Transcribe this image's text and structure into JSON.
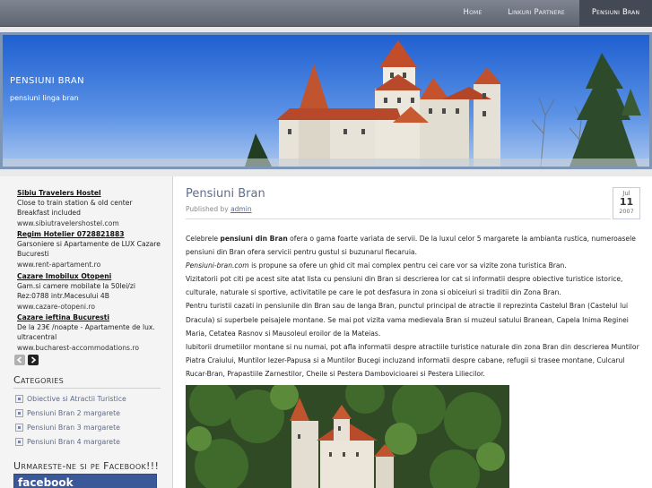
{
  "nav": {
    "items": [
      {
        "label": "Home"
      },
      {
        "label": "Linkuri Partnere"
      },
      {
        "label": "Pensiuni Bran",
        "active": true
      }
    ]
  },
  "header": {
    "title": "PENSIUNI BRAN",
    "tagline": "pensiuni linga bran"
  },
  "sidebar": {
    "ads": [
      {
        "title": "Sibiu Travelers Hostel",
        "text": "Close to train station & old center Breakfast included",
        "url": "www.sibiutravelershostel.com"
      },
      {
        "title": "Regim Hotelier 0728821883",
        "text": "Garsoniere si Apartamente de LUX Cazare Bucuresti",
        "url": "www.rent-apartament.ro"
      },
      {
        "title": "Cazare Imobilux Otopeni",
        "text": "Gam.si camere mobilate la 50lei/zi Rez:0788 intr.Macesului 4B",
        "url": "www.cazare-otopeni.ro"
      },
      {
        "title": "Cazare ieftina Bucuresti",
        "text": "De la 23€ /noapte - Apartamente de lux. ultracentral",
        "url": "www.bucharest-accommodations.ro"
      }
    ],
    "categories_heading": "Categories",
    "categories": [
      "Obiective si Atractii Turistice",
      "Pensiuni Bran 2 margarete",
      "Pensiuni Bran 3 margarete",
      "Pensiuni Bran 4 margarete"
    ],
    "facebook_heading": "Urmareste-ne si pe Facebook!!!",
    "facebook_logo": "facebook"
  },
  "post": {
    "title": "Pensiuni Bran",
    "meta_prefix": "Published by ",
    "author": "admin",
    "date": {
      "month": "Jul",
      "day": "11",
      "year": "2007"
    },
    "paragraphs": [
      {
        "pre": "Celebrele ",
        "bold": "pensiuni din Bran",
        "post": " ofera o gama foarte variata de servii. De la luxul celor 5 margarete la ambianta rustica, numeroasele pensiuni din Bran ofera servicii pentru gustul si buzunarul fiecaruia."
      },
      {
        "italic": "Pensiuni-bran.com",
        "post": " is propune sa ofere un ghid cit mai complex pentru cei care vor sa vizite zona turistica Bran."
      },
      {
        "post": "Vizitatorii pot citi pe acest site atat lista cu pensiuni din Bran si descrierea lor cat si informatii despre obiective turistice istorice, culturale, naturale si sportive, activitatile pe care le pot desfasura in zona si obiceiuri si traditii din Zona Bran."
      },
      {
        "post": "Pentru turistii cazati in pensiunile din Bran sau de langa Bran, punctul principal de atractie il reprezinta Castelul Bran (Castelul lui Dracula) si superbele peisajele montane. Se mai pot vizita vama medievala Bran si muzeul satului Branean, Capela Inima Reginei Maria, Cetatea Rasnov si Mausoleul eroilor de la Mateias."
      },
      {
        "post": "Iubitorii drumetiilor montane si nu numai, pot afla informatii despre atractiile turistice naturale din zona Bran din descrierea Muntilor Piatra Craiului, Muntilor Iezer-Papusa si a Muntilor Bucegi incluzand informatii despre cabane, refugii si trasee montane, Culcarul Rucar-Bran, Prapastiile Zarnestilor, Cheile si Pestera Dambovicioarei si Pestera Liliecilor."
      }
    ]
  },
  "colors": {
    "nav_bg": "#6e7580",
    "nav_active": "#434a55",
    "header_frame": "#7d96b8",
    "link": "#5f6d90",
    "facebook": "#3b5998"
  }
}
